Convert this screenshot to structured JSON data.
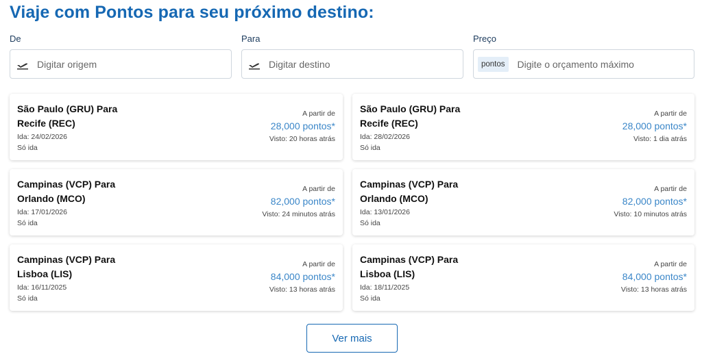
{
  "title": "Viaje com Pontos para seu próximo destino:",
  "filters": {
    "origin": {
      "label": "De",
      "placeholder": "Digitar origem",
      "icon": "plane-takeoff-icon"
    },
    "destination": {
      "label": "Para",
      "placeholder": "Digitar destino",
      "icon": "plane-takeoff-icon"
    },
    "price": {
      "label": "Preço",
      "chip": "pontos",
      "placeholder": "Digite o orçamento máximo"
    }
  },
  "cards": [
    {
      "route": "São Paulo (GRU) Para Recife (REC)",
      "date": "Ida: 24/02/2026",
      "trip_type": "Só ida",
      "from_label": "A partir de",
      "price": "28,000 pontos*",
      "seen": "Visto: 20 horas atrás"
    },
    {
      "route": "São Paulo (GRU) Para Recife (REC)",
      "date": "Ida: 28/02/2026",
      "trip_type": "Só ida",
      "from_label": "A partir de",
      "price": "28,000 pontos*",
      "seen": "Visto: 1 dia atrás"
    },
    {
      "route": "Campinas (VCP) Para Orlando (MCO)",
      "date": "Ida: 17/01/2026",
      "trip_type": "Só ida",
      "from_label": "A partir de",
      "price": "82,000 pontos*",
      "seen": "Visto: 24 minutos atrás"
    },
    {
      "route": "Campinas (VCP) Para Orlando (MCO)",
      "date": "Ida: 13/01/2026",
      "trip_type": "Só ida",
      "from_label": "A partir de",
      "price": "82,000 pontos*",
      "seen": "Visto: 10 minutos atrás"
    },
    {
      "route": "Campinas (VCP) Para Lisboa (LIS)",
      "date": "Ida: 16/11/2025",
      "trip_type": "Só ida",
      "from_label": "A partir de",
      "price": "84,000 pontos*",
      "seen": "Visto: 13 horas atrás"
    },
    {
      "route": "Campinas (VCP) Para Lisboa (LIS)",
      "date": "Ida: 18/11/2025",
      "trip_type": "Só ida",
      "from_label": "A partir de",
      "price": "84,000 pontos*",
      "seen": "Visto: 13 horas atrás"
    }
  ],
  "more_button": "Ver mais",
  "colors": {
    "accent": "#1668b3",
    "price": "#3a86c8"
  }
}
